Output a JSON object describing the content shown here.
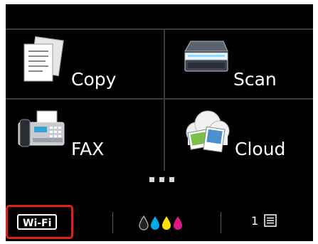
{
  "tiles": {
    "copy": {
      "label": "Copy",
      "icon": "copy-documents-icon"
    },
    "scan": {
      "label": "Scan",
      "icon": "scanner-icon"
    },
    "fax": {
      "label": "FAX",
      "icon": "fax-machine-icon"
    },
    "cloud": {
      "label": "Cloud",
      "icon": "cloud-photos-icon"
    }
  },
  "page_indicator": {
    "pages": 3,
    "current": 1
  },
  "bottom_bar": {
    "wifi_label": "Wi-Fi",
    "highlight_color": "#e02020",
    "ink_colors": [
      "#222222",
      "#00a8e8",
      "#ffe000",
      "#e0198a"
    ],
    "queue_count": "1"
  }
}
